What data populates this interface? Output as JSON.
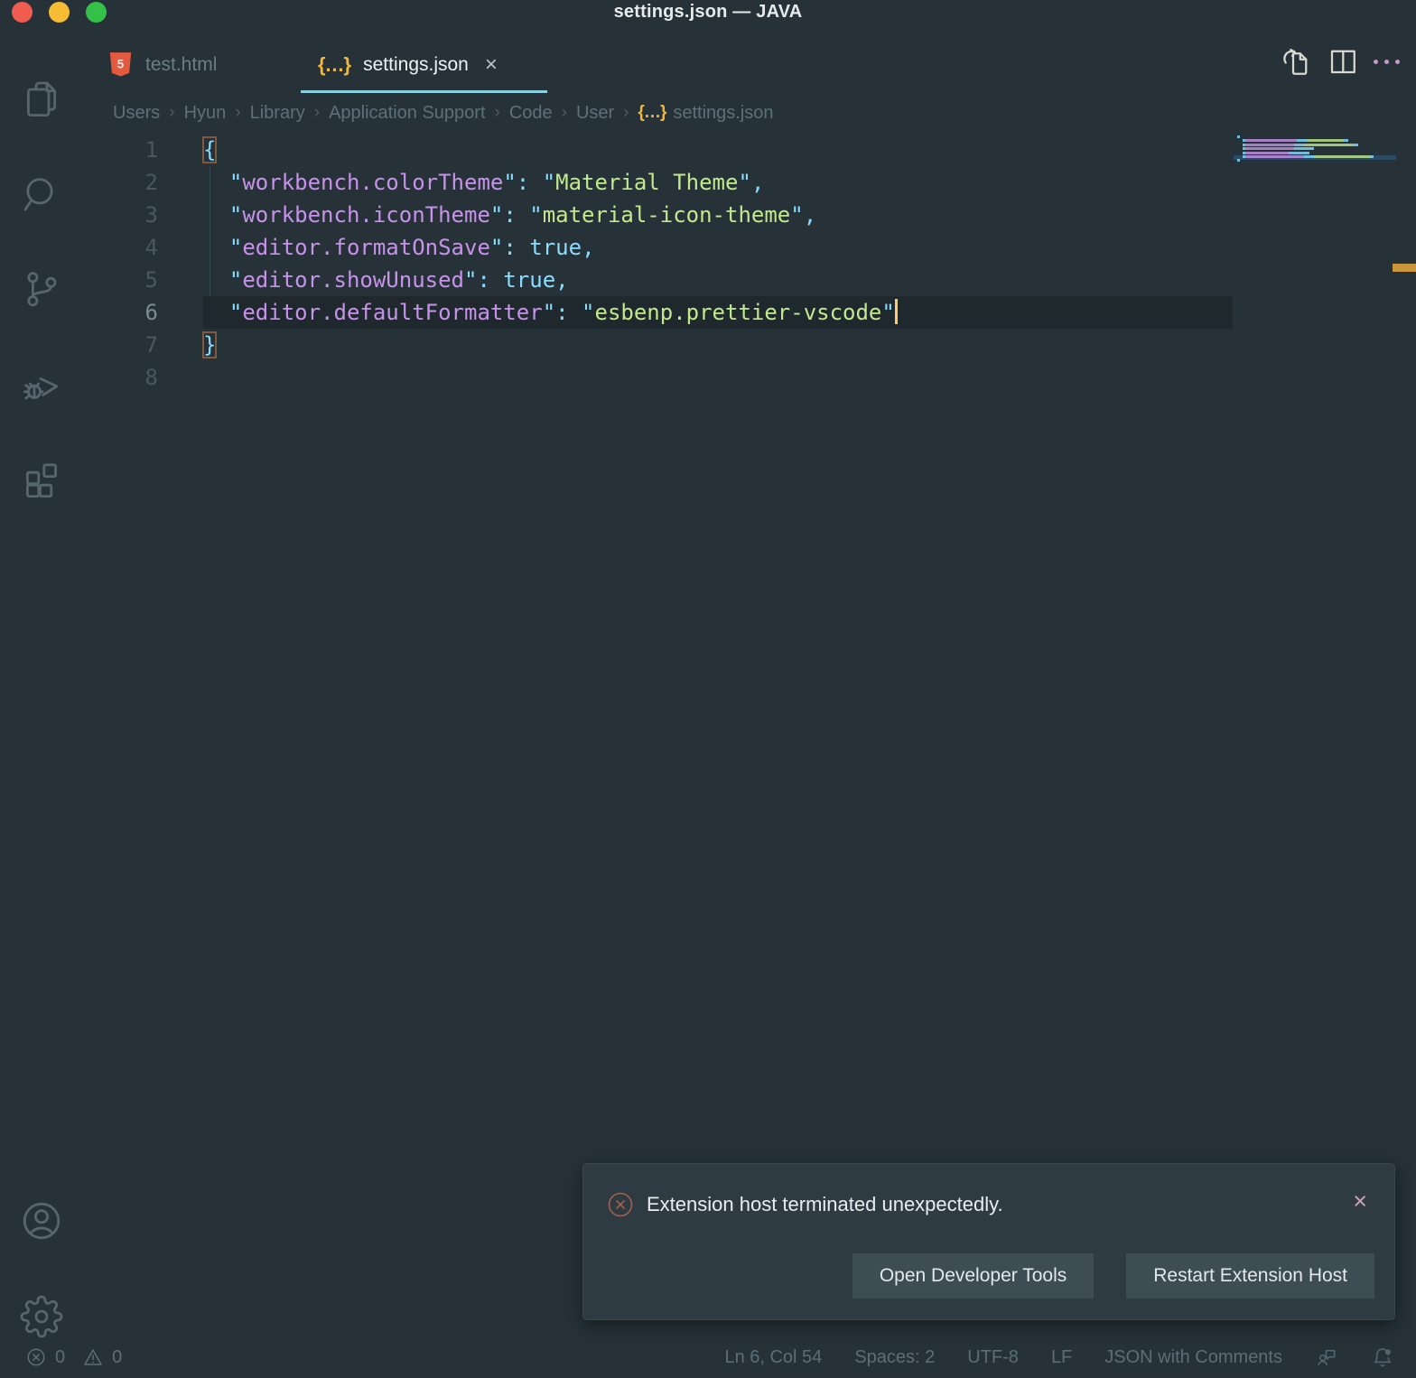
{
  "window": {
    "title": "settings.json — JAVA"
  },
  "theme": {
    "background": "#263238",
    "accent_underline": "#89cfe0",
    "cursor": "#FFCB6B",
    "punctuation": "#89DDFF",
    "property": "#C792EA",
    "string": "#C3E88D",
    "error_icon": "#a2604f",
    "json_icon": "#f3b73c",
    "html_icon": "#e5593f"
  },
  "activity_bar": {
    "items": [
      "explorer",
      "search",
      "source-control",
      "run-and-debug",
      "extensions"
    ],
    "bottom_items": [
      "accounts",
      "manage-settings"
    ]
  },
  "tabs": [
    {
      "label": "test.html",
      "icon": "html5-icon",
      "active": false
    },
    {
      "label": "settings.json",
      "icon": "json-braces-icon",
      "active": true,
      "close_glyph": "×"
    }
  ],
  "editor_actions": [
    "open-changes",
    "split-editor",
    "more-actions"
  ],
  "breadcrumbs": [
    "Users",
    "Hyun",
    "Library",
    "Application Support",
    "Code",
    "User",
    "settings.json"
  ],
  "code": {
    "lines": [
      {
        "n": "1",
        "tokens": [
          [
            "{",
            "p",
            "m"
          ]
        ]
      },
      {
        "n": "2",
        "tokens": [
          [
            "  ",
            "w"
          ],
          [
            "\"",
            "p"
          ],
          [
            "workbench.colorTheme",
            "k"
          ],
          [
            "\": \"",
            "p"
          ],
          [
            "Material Theme",
            "s"
          ],
          [
            "\",",
            "p"
          ]
        ]
      },
      {
        "n": "3",
        "tokens": [
          [
            "  ",
            "w"
          ],
          [
            "\"",
            "p"
          ],
          [
            "workbench.iconTheme",
            "k"
          ],
          [
            "\": \"",
            "p"
          ],
          [
            "material-icon-theme",
            "s"
          ],
          [
            "\",",
            "p"
          ]
        ]
      },
      {
        "n": "4",
        "tokens": [
          [
            "  ",
            "w"
          ],
          [
            "\"",
            "p"
          ],
          [
            "editor.formatOnSave",
            "k"
          ],
          [
            "\": ",
            "p"
          ],
          [
            "true",
            "b"
          ],
          [
            ",",
            "p"
          ]
        ]
      },
      {
        "n": "5",
        "tokens": [
          [
            "  ",
            "w"
          ],
          [
            "\"",
            "p"
          ],
          [
            "editor.showUnused",
            "k"
          ],
          [
            "\": ",
            "p"
          ],
          [
            "true",
            "b"
          ],
          [
            ",",
            "p"
          ]
        ]
      },
      {
        "n": "6",
        "tokens": [
          [
            "  ",
            "w"
          ],
          [
            "\"",
            "p"
          ],
          [
            "editor.defaultFormatter",
            "k"
          ],
          [
            "\": \"",
            "p"
          ],
          [
            "esbenp.prettier-vscode",
            "s"
          ],
          [
            "\"",
            "p"
          ]
        ],
        "current": true,
        "cursor": true
      },
      {
        "n": "7",
        "tokens": [
          [
            "}",
            "p",
            "m"
          ]
        ]
      },
      {
        "n": "8",
        "tokens": []
      }
    ]
  },
  "notification": {
    "message": "Extension host terminated unexpectedly.",
    "close_glyph": "×",
    "buttons": [
      "Open Developer Tools",
      "Restart Extension Host"
    ]
  },
  "status_bar": {
    "errors": "0",
    "warnings": "0",
    "right_items": [
      "Ln 6, Col 54",
      "Spaces: 2",
      "UTF-8",
      "LF",
      "JSON with Comments"
    ],
    "right_icons": [
      "feedback",
      "notifications-bell"
    ]
  }
}
